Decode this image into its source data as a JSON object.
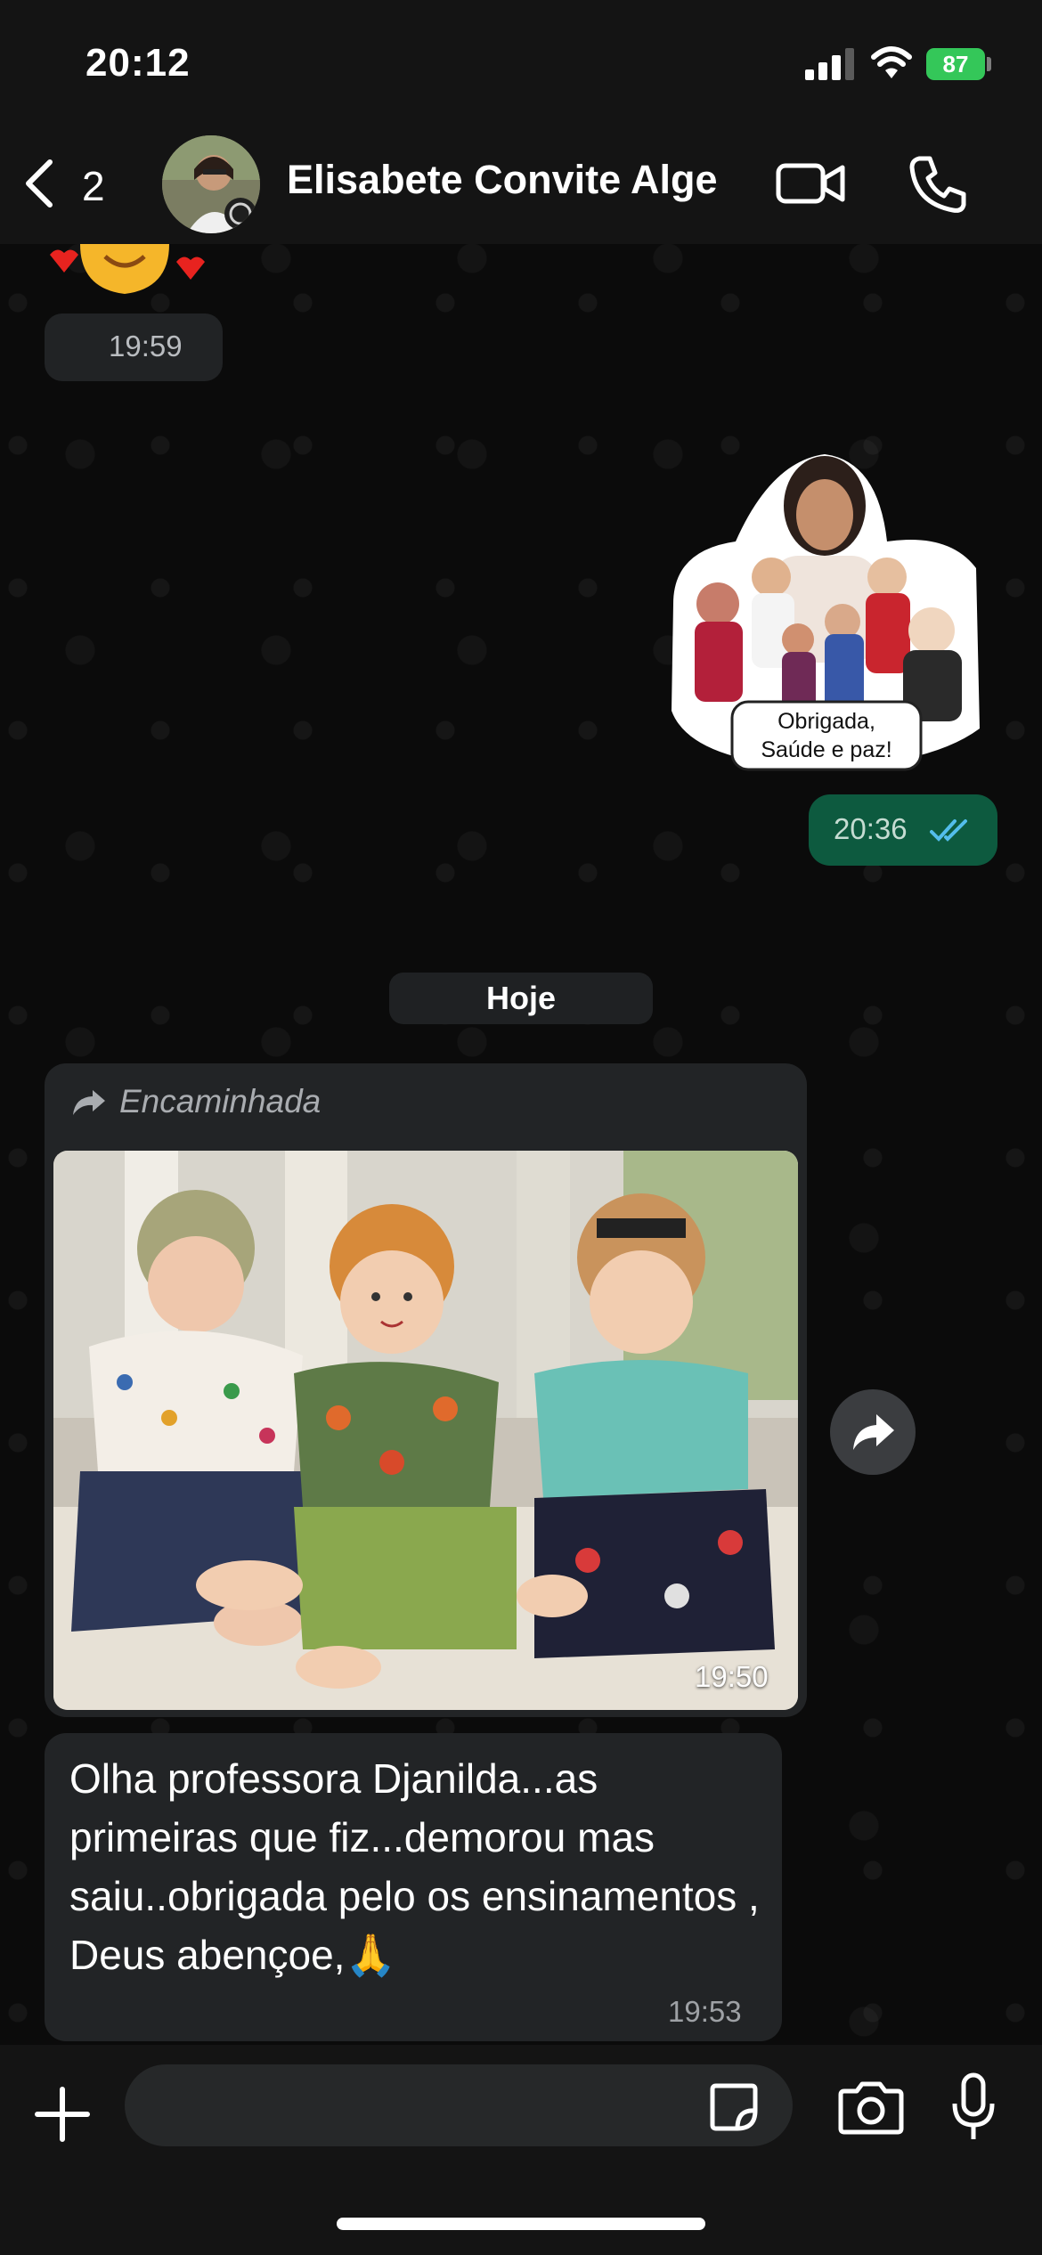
{
  "status_bar": {
    "time": "20:12",
    "battery": "87"
  },
  "header": {
    "back_count": "2",
    "contact_name": "Elisabete Convite Alge",
    "icons": [
      "back-chevron-icon",
      "avatar",
      "video-call-icon",
      "phone-icon"
    ]
  },
  "messages": {
    "prev_time": "19:59",
    "sticker_caption_line1": "Obrigada,",
    "sticker_caption_line2": "Saúde e paz!",
    "sent_time": "20:36",
    "date_divider": "Hoje",
    "forwarded_label": "Encaminhada",
    "photo_time": "19:50",
    "text_message": "Olha  professora Djanilda...as primeiras que fiz...demorou mas saiu..obrigada pelo os ensinamentos , Deus abençoe,🙏",
    "text_time": "19:53"
  },
  "composer": {
    "placeholder": "",
    "icons": [
      "plus-icon",
      "sticker-icon",
      "camera-icon",
      "microphone-icon"
    ]
  },
  "colors": {
    "background": "#0b0b0b",
    "incoming_bubble": "#222426",
    "outgoing_bubble": "#0d5a3f",
    "battery": "#34c759",
    "read_ticks": "#53bdeb"
  }
}
